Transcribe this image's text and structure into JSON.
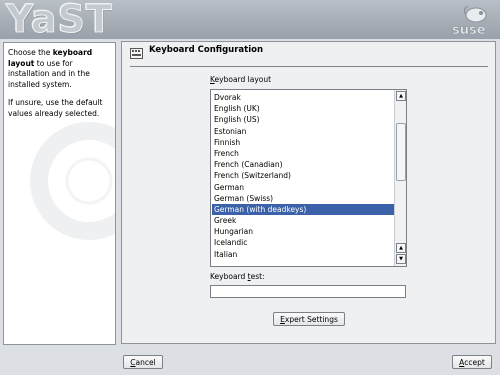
{
  "banner": {
    "logo_text": "YaST",
    "brand": "suse"
  },
  "help": {
    "p1_before": "Choose the ",
    "p1_bold": "keyboard layout",
    "p1_after": " to use for installation and in the installed system.",
    "p2": "If unsure, use the default values already selected."
  },
  "main": {
    "title": "Keyboard Configuration",
    "layout_label_hotkey": "K",
    "layout_label_rest": "eyboard layout",
    "layouts": [
      "Dvorak",
      "English (UK)",
      "English (US)",
      "Estonian",
      "Finnish",
      "French",
      "French (Canadian)",
      "French (Switzerland)",
      "German",
      "German (Swiss)",
      "German (with deadkeys)",
      "Greek",
      "Hungarian",
      "Icelandic",
      "Italian"
    ],
    "selected_layout": "German (with deadkeys)",
    "test_label_before": "Keyboard ",
    "test_label_hotkey": "t",
    "test_label_after": "est:",
    "test_value": "",
    "expert_hotkey": "E",
    "expert_rest": "xpert Settings"
  },
  "footer": {
    "cancel_hotkey": "C",
    "cancel_rest": "ancel",
    "accept_hotkey": "A",
    "accept_rest": "ccept"
  },
  "colors": {
    "selection": "#3b62a9",
    "banner": "#a5acb4"
  }
}
